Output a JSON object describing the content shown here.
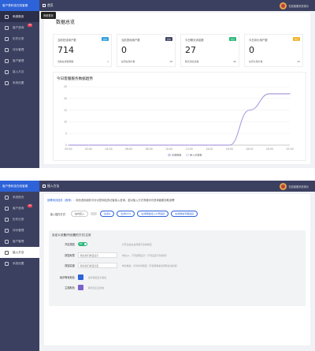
{
  "colors": {
    "brand": "#2d62d8",
    "sidebar": "#3c4060",
    "accent_green": "#2ab87a",
    "line": "#7b62c9"
  },
  "icons": {
    "menu": "menu-icon",
    "home": "home-icon",
    "user": "avatar"
  },
  "app": {
    "brand": "客户慧科技在线客服"
  },
  "user": {
    "name": "在线客服系统演示"
  },
  "shot1": {
    "breadcrumb": "首页",
    "sidebar": [
      {
        "label": "系统首页",
        "badge": ""
      },
      {
        "label": "客户咨询",
        "badge": "33"
      },
      {
        "label": "历史记录",
        "badge": ""
      },
      {
        "label": "评价管理",
        "badge": ""
      },
      {
        "label": "客户管理",
        "badge": ""
      },
      {
        "label": "接入方法",
        "badge": ""
      },
      {
        "label": "系统设置",
        "badge": ""
      }
    ],
    "tooltip": "系统首页",
    "panel_title": "数据总览",
    "stats": [
      {
        "label": "当前在线用户数",
        "tag": "实时",
        "tag_color": "#2d9cdb",
        "value": "714",
        "foot_label": "当前在线客服数",
        "foot_value": "1"
      },
      {
        "label": "当前咨询用户数",
        "tag": "实时",
        "tag_color": "#3c4060",
        "value": "0",
        "foot_label": "接待总用户数",
        "foot_value": "18"
      },
      {
        "label": "今日聊天消息数",
        "tag": "今日",
        "tag_color": "#2ab87a",
        "value": "27",
        "foot_label": "聊天消息总数",
        "foot_value": "90"
      },
      {
        "label": "今日评价用户数",
        "tag": "今日",
        "tag_color": "#f0b429",
        "value": "0",
        "foot_label": "总评价用户数",
        "foot_value": "29"
      }
    ],
    "chart_title": "今日客服服务数据趋势"
  },
  "chart_data": {
    "type": "line",
    "title": "今日客服服务数据趋势",
    "x": [
      "00:00",
      "02:00",
      "04:00",
      "06:00",
      "08:00",
      "10:00",
      "12:00",
      "14:00",
      "16:00",
      "18:00",
      "20:00",
      "22:00"
    ],
    "ylim": [
      0,
      25
    ],
    "yticks": [
      0,
      5,
      10,
      15,
      20,
      25
    ],
    "series": [
      {
        "name": "访客数量",
        "values": [
          0,
          0,
          0,
          0,
          0,
          0,
          0,
          0,
          0,
          15,
          22,
          22
        ]
      },
      {
        "name": "接入访客数",
        "values": [
          0,
          0,
          0,
          0,
          0,
          0,
          0,
          0,
          0,
          15,
          22,
          22
        ]
      }
    ],
    "legend_position": "bottom",
    "grid": true
  },
  "shot2": {
    "breadcrumb": "接入方法",
    "sidebar": [
      {
        "label": "系统首页",
        "badge": ""
      },
      {
        "label": "客户咨询",
        "badge": "12"
      },
      {
        "label": "历史记录",
        "badge": ""
      },
      {
        "label": "评价管理",
        "badge": ""
      },
      {
        "label": "客户管理",
        "badge": ""
      },
      {
        "label": "接入方法",
        "badge": ""
      },
      {
        "label": "系统设置",
        "badge": ""
      }
    ],
    "notice_prefix": "部署网页插件（推荐）：",
    "notice_text": "网页咨询组件可针对您网站的访客接入咨询，若对接入方式有疑问可咨询客服协助部署",
    "row1_label": "接入插件方式：",
    "row1_option": "站内接入",
    "row1_chips": [
      "生成js",
      "生成html",
      "生成网络加公众号链接",
      "生成微信专属链接"
    ],
    "section_title": "自定义设置(所设置的方式)生效",
    "fields": [
      {
        "label": "开启按钮",
        "type": "switch",
        "switch_text": "ON",
        "hint": "打开后会在右侧展示咨询按钮"
      },
      {
        "label": "按钮标签",
        "type": "input",
        "placeholder": "联系我们按钮显示",
        "hint": "单位px，不同屏幕显示（不同设置不同的项）"
      },
      {
        "label": "按钮高度",
        "type": "input",
        "placeholder": "联系我们按钮高度",
        "hint": "单位像素，针对中间按钮（可使用像素值调整合适的值）"
      },
      {
        "label": "悬浮等待颜色",
        "type": "color",
        "color": "#2d62d8",
        "hint": "悬浮按钮显示颜色"
      },
      {
        "label": "主题颜色",
        "type": "color",
        "color": "#7b62c9",
        "hint": "聊天窗口主题色"
      }
    ]
  }
}
